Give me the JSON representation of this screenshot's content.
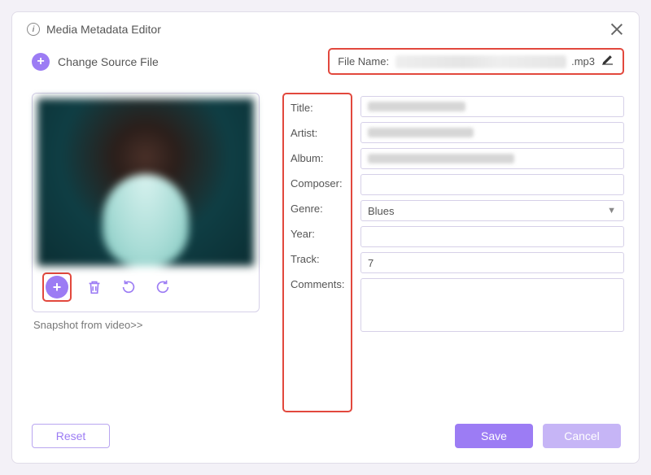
{
  "dialog": {
    "title": "Media Metadata Editor"
  },
  "toprow": {
    "change_source": "Change Source File",
    "filename_label": "File Name:",
    "filename_ext": ".mp3"
  },
  "leftpane": {
    "snapshot_link": "Snapshot from video>>"
  },
  "labels": {
    "title": "Title:",
    "artist": "Artist:",
    "album": "Album:",
    "composer": "Composer:",
    "genre": "Genre:",
    "year": "Year:",
    "track": "Track:",
    "comments": "Comments:"
  },
  "fields": {
    "title": "",
    "artist": "",
    "album": "",
    "composer": "",
    "genre": "Blues",
    "year": "",
    "track": "7",
    "comments": ""
  },
  "footer": {
    "reset": "Reset",
    "save": "Save",
    "cancel": "Cancel"
  }
}
